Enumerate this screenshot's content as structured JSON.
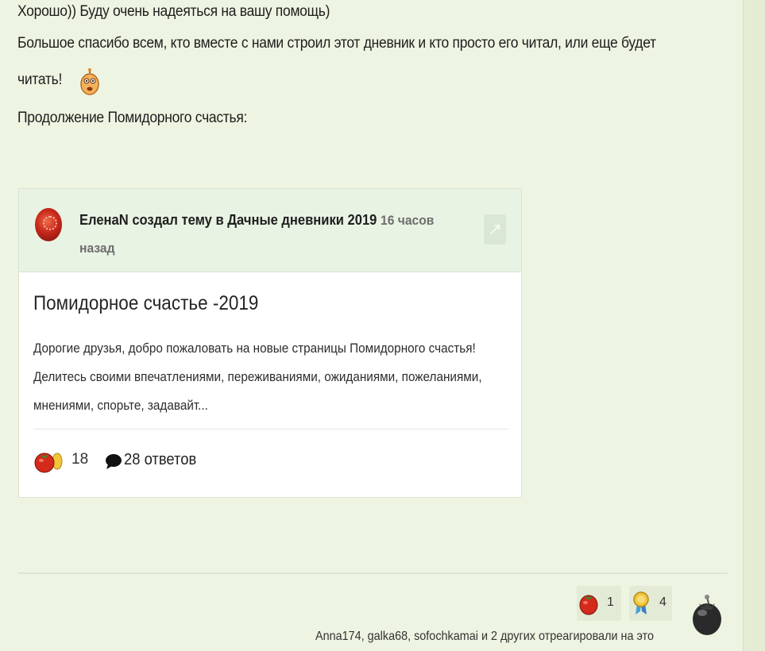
{
  "post": {
    "lines": [
      "Хорошо))  Буду очень надеяться на вашу помощь)",
      "Большое спасибо всем, кто вместе с нами строил этот дневник и кто просто его читал, или еще будет",
      "читать!",
      "Продолжение Помидорного счастья:"
    ]
  },
  "embed": {
    "author_line": "ЕленаN создал тему в Дачные дневники 2019",
    "time": "16 часов назад",
    "title": "Помидорное счастье -2019",
    "excerpt": "Дорогие друзья, добро пожаловать на новые страницы Помидорного счастья!  Делитесь своими впечатлениями, переживаниями, ожиданиями, пожеланиями, мнениями, спорьте, задавайт...",
    "reactions_count": "18",
    "replies": "28 ответов",
    "share_icon": "share-arrow-icon"
  },
  "reactions": {
    "tomato_count": "1",
    "medal_count": "4",
    "summary": "Anna174, galka68, sofochkamai и 2 других отреагировали на это"
  },
  "colors": {
    "page_bg": "#eef4e2",
    "card_header_bg": "#e9f3e4",
    "tomato": "#d42a1c"
  }
}
